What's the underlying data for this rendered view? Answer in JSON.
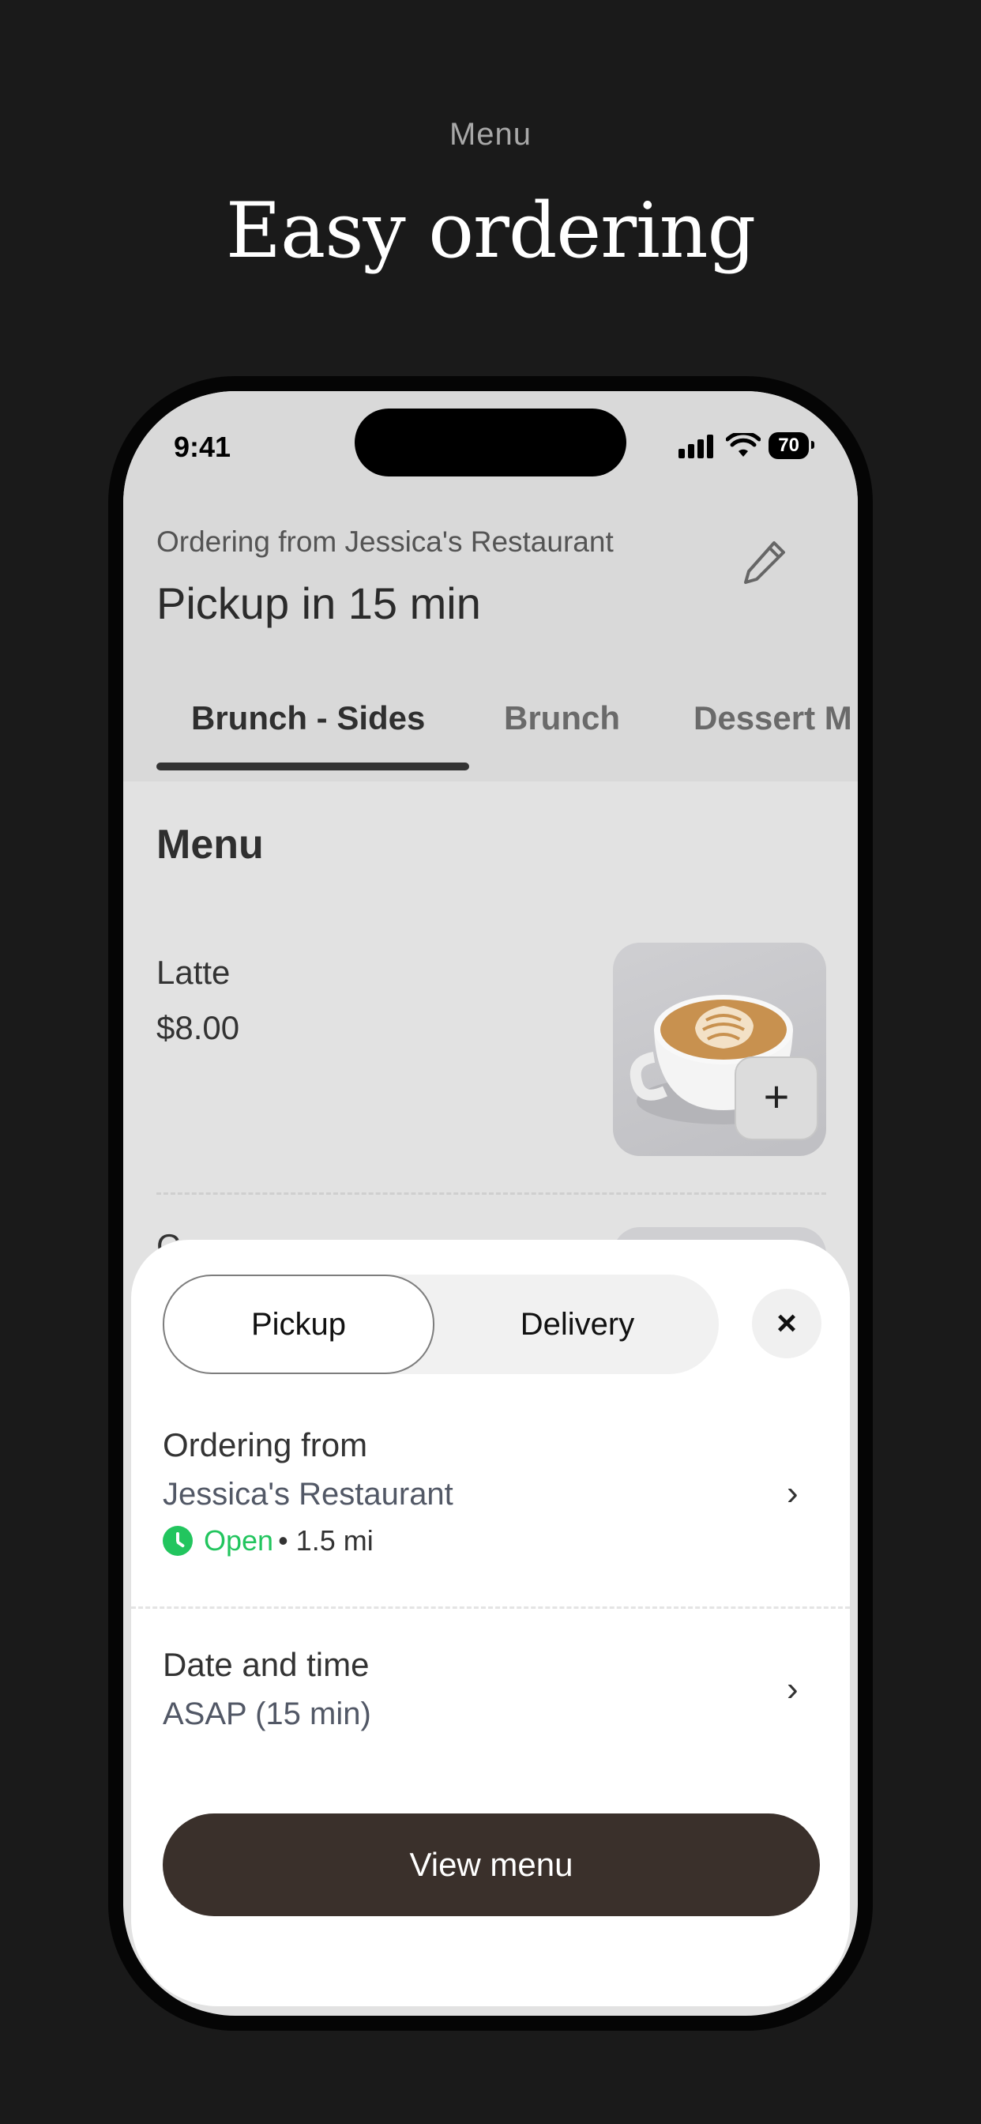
{
  "marketing": {
    "eyebrow": "Menu",
    "headline": "Easy ordering"
  },
  "status_bar": {
    "time": "9:41",
    "battery": "70"
  },
  "header": {
    "ordering_from": "Ordering from Jessica's Restaurant",
    "pickup_title": "Pickup in 15 min"
  },
  "tabs": [
    {
      "label": "Brunch - Sides",
      "active": true
    },
    {
      "label": "Brunch",
      "active": false
    },
    {
      "label": "Dessert M",
      "active": false
    }
  ],
  "menu": {
    "heading": "Menu",
    "items": [
      {
        "name": "Latte",
        "price": "$8.00"
      }
    ],
    "peek_text": "C"
  },
  "sheet": {
    "segments": {
      "pickup": "Pickup",
      "delivery": "Delivery"
    },
    "close": "×",
    "ordering_from": {
      "title": "Ordering from",
      "restaurant": "Jessica's Restaurant",
      "status": "Open",
      "distance": "• 1.5 mi"
    },
    "date_time": {
      "title": "Date and time",
      "value": "ASAP (15 min)"
    },
    "cta": "View menu"
  },
  "colors": {
    "background": "#1a1a1a",
    "accent_button": "#3a302b",
    "open_status": "#22c55e"
  },
  "icons": [
    "signal-icon",
    "wifi-icon",
    "battery-icon",
    "pencil-icon",
    "plus-icon",
    "close-icon",
    "clock-icon",
    "chevron-right-icon"
  ]
}
